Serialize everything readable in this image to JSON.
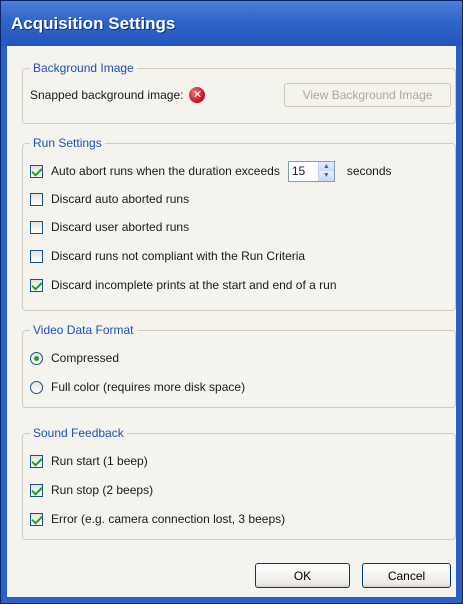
{
  "window": {
    "title": "Acquisition Settings"
  },
  "background_image": {
    "legend": "Background Image",
    "snapped_label": "Snapped background image:",
    "status_icon": "error-x-icon",
    "view_button": "View Background Image"
  },
  "run_settings": {
    "legend": "Run Settings",
    "auto_abort": {
      "label": "Auto abort runs when the duration exceeds",
      "checked": true,
      "value": "15",
      "unit": "seconds"
    },
    "discard_auto": {
      "label": "Discard auto aborted runs",
      "checked": false
    },
    "discard_user": {
      "label": "Discard user aborted runs",
      "checked": false
    },
    "discard_noncompliant": {
      "label": "Discard runs not compliant with the Run Criteria",
      "checked": false
    },
    "discard_incomplete": {
      "label": "Discard incomplete prints at the start and end of a run",
      "checked": true
    }
  },
  "video_format": {
    "legend": "Video Data Format",
    "compressed": {
      "label": "Compressed",
      "selected": true
    },
    "full_color": {
      "label": "Full color (requires more disk space)",
      "selected": false
    }
  },
  "sound_feedback": {
    "legend": "Sound Feedback",
    "run_start": {
      "label": "Run start (1 beep)",
      "checked": true
    },
    "run_stop": {
      "label": "Run stop (2 beeps)",
      "checked": true
    },
    "error": {
      "label": "Error (e.g. camera connection lost, 3 beeps)",
      "checked": true
    }
  },
  "buttons": {
    "ok": "OK",
    "cancel": "Cancel"
  },
  "colors": {
    "titlebar": "#2f65c9",
    "legend_text": "#2150b8",
    "check_mark": "#21a121"
  }
}
